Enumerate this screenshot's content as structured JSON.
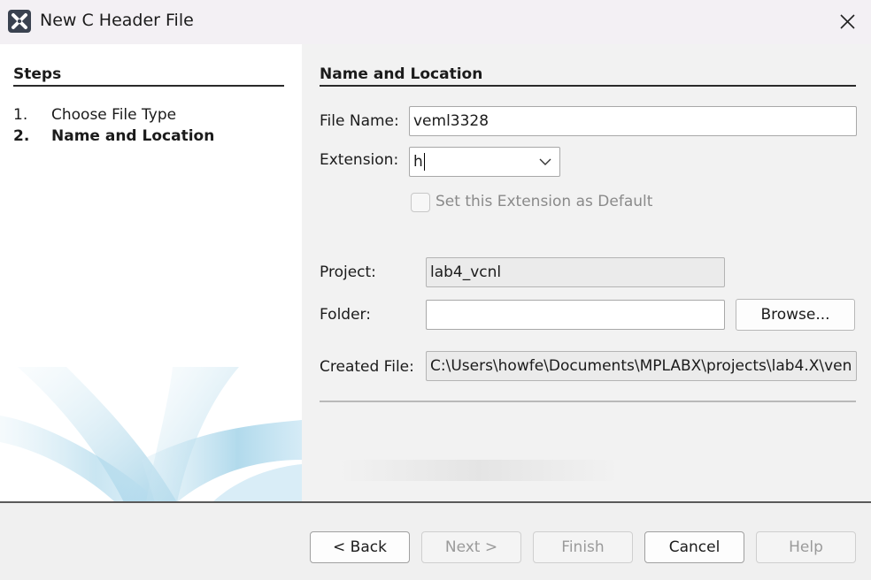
{
  "window": {
    "title": "New C Header File",
    "icon": "mplabx-icon",
    "close_icon": "close-icon"
  },
  "steps": {
    "title": "Steps",
    "items": [
      {
        "number": "1.",
        "label": "Choose File Type",
        "current": false
      },
      {
        "number": "2.",
        "label": "Name and Location",
        "current": true
      }
    ]
  },
  "form": {
    "section_title": "Name and Location",
    "file_name": {
      "label": "File Name:",
      "value": "veml3328"
    },
    "extension": {
      "label": "Extension:",
      "value": "h"
    },
    "set_default": {
      "label": "Set this Extension as Default",
      "checked": false,
      "enabled": false
    },
    "project": {
      "label": "Project:",
      "value": "lab4_vcnl"
    },
    "folder": {
      "label": "Folder:",
      "value": ""
    },
    "browse_label": "Browse...",
    "created_file": {
      "label": "Created File:",
      "value": "C:\\Users\\howfe\\Documents\\MPLABX\\projects\\lab4.X\\ven"
    }
  },
  "footer": {
    "back_label": "< Back",
    "next_label": "Next >",
    "finish_label": "Finish",
    "cancel_label": "Cancel",
    "help_label": "Help"
  },
  "colors": {
    "steps_background": "#ffffff",
    "content_background": "#f2f2f2",
    "swoosh_blue": "#9fd0e6"
  }
}
